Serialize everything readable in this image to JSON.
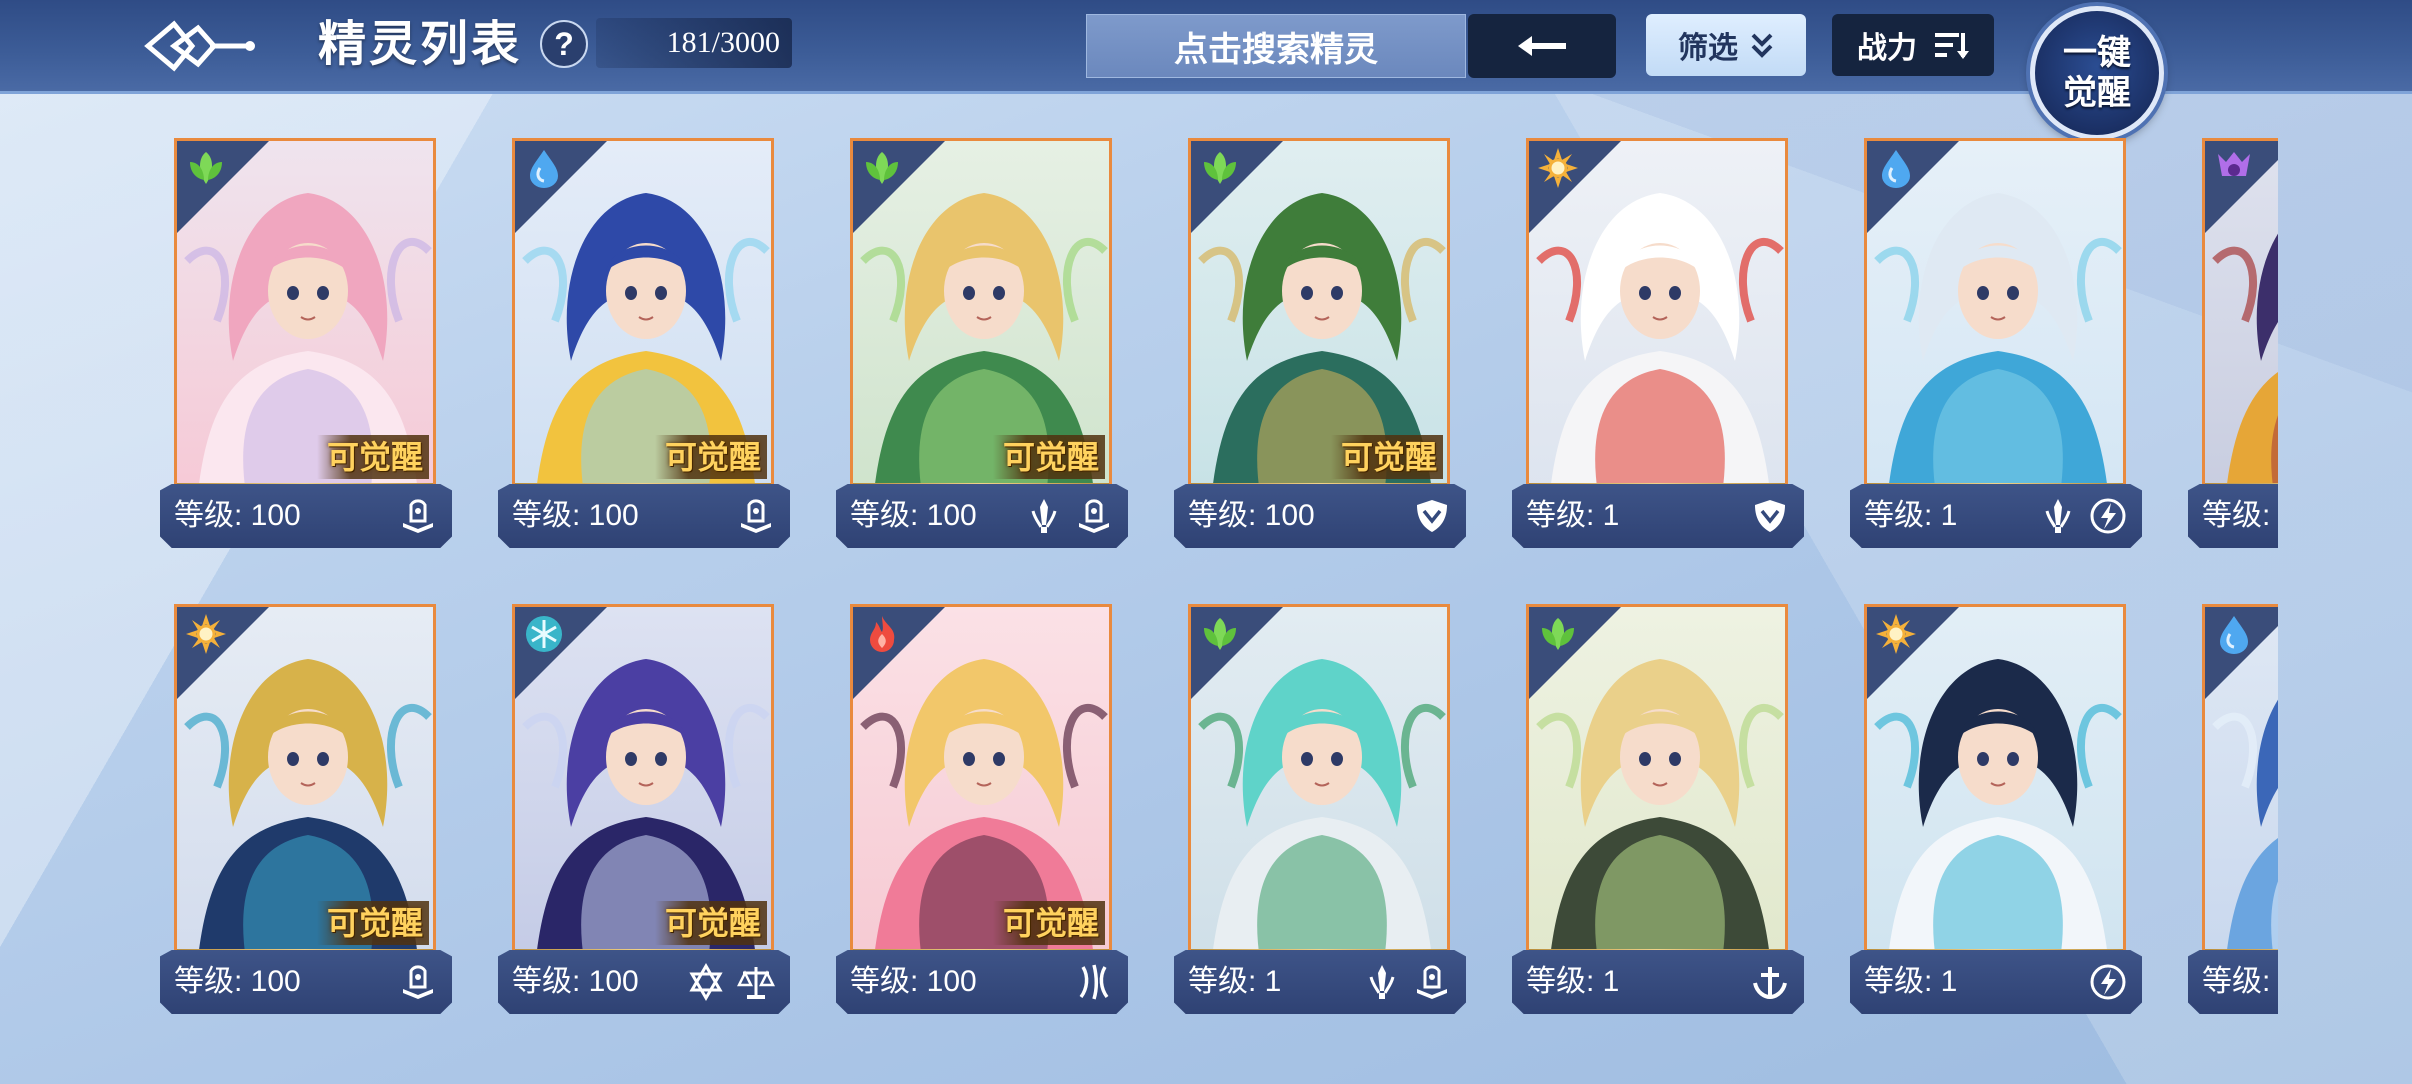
{
  "header": {
    "title": "精灵列表",
    "help": "?",
    "count": "181/3000",
    "search_placeholder": "点击搜索精灵",
    "filter_label": "筛选",
    "power_label": "战力",
    "awaken_line1": "一键",
    "awaken_line2": "觉醒"
  },
  "awaken_tag": "可觉醒",
  "colors": {
    "topbar": "#2f4c86",
    "card_border": "#e98a3e",
    "awaken_text": "#ffd25e",
    "level_bar": "#34497c"
  },
  "rows": [
    [
      {
        "element": "grass-icon",
        "level": "等级: 100",
        "awaken": true,
        "classes": [
          "book-icon"
        ],
        "art": "pink-fairy"
      },
      {
        "element": "water-icon",
        "level": "等级: 100",
        "awaken": true,
        "classes": [
          "book-icon"
        ],
        "art": "blue-dragon"
      },
      {
        "element": "grass-icon",
        "level": "等级: 100",
        "awaken": true,
        "classes": [
          "sword-icon",
          "book-icon"
        ],
        "art": "blonde-dryad"
      },
      {
        "element": "grass-icon",
        "level": "等级: 100",
        "awaken": true,
        "classes": [
          "shield-icon"
        ],
        "art": "green-warrior"
      },
      {
        "element": "light-icon",
        "level": "等级: 1",
        "awaken": false,
        "classes": [
          "shield-icon"
        ],
        "art": "white-sheep"
      },
      {
        "element": "water-icon",
        "level": "等级: 1",
        "awaken": false,
        "classes": [
          "sword-icon",
          "lightning-icon"
        ],
        "art": "cyan-mage"
      },
      {
        "element": "shadow-icon",
        "level": "等级:",
        "awaken": false,
        "classes": [],
        "art": "dark-star"
      }
    ],
    [
      {
        "element": "light-icon",
        "level": "等级: 100",
        "awaken": true,
        "classes": [
          "book-icon"
        ],
        "art": "gold-dragon"
      },
      {
        "element": "ice-icon",
        "level": "等级: 100",
        "awaken": true,
        "classes": [
          "star-icon",
          "balance-icon"
        ],
        "art": "purple-demon"
      },
      {
        "element": "fire-icon",
        "level": "等级: 100",
        "awaken": true,
        "classes": [
          "claw-icon"
        ],
        "art": "foxgirl"
      },
      {
        "element": "grass-icon",
        "level": "等级: 1",
        "awaken": false,
        "classes": [
          "sword-icon",
          "book-icon"
        ],
        "art": "armored-knight"
      },
      {
        "element": "grass-icon",
        "level": "等级: 1",
        "awaken": false,
        "classes": [
          "anchor-icon"
        ],
        "art": "elf-maiden"
      },
      {
        "element": "light-icon",
        "level": "等级: 1",
        "awaken": false,
        "classes": [
          "lightning-icon"
        ],
        "art": "hooded-boy"
      },
      {
        "element": "water-icon",
        "level": "等级:",
        "awaken": false,
        "classes": [],
        "art": "blue-creature"
      }
    ]
  ]
}
